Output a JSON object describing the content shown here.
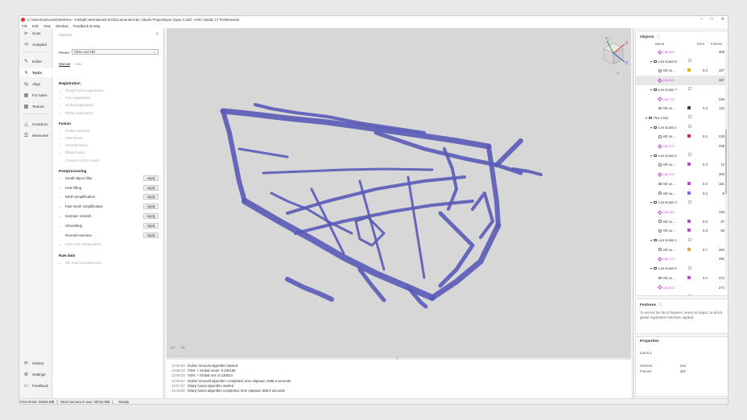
{
  "window": {
    "title": "C:\\Users\\u34ocan\\OneDrive - Kimball International Inc\\Documents\\Artec Studio Projects\\pos 2\\pos 2.a3d - Artec Studio 17 Professional",
    "minimize": "–",
    "maximize": "□",
    "close": "✕"
  },
  "menu": [
    "File",
    "Edit",
    "View",
    "Window",
    "Feedback & Help"
  ],
  "nav": {
    "items": [
      {
        "label": "Scan",
        "icon": "scan-icon",
        "glyph": "⊳"
      },
      {
        "label": "Autopilot",
        "icon": "autopilot-icon",
        "glyph": "⟲"
      },
      {
        "label": "Editor",
        "icon": "editor-icon",
        "glyph": "✎"
      },
      {
        "label": "Tools",
        "icon": "tools-icon",
        "glyph": "ϟ"
      },
      {
        "label": "Align",
        "icon": "align-icon",
        "glyph": "⇆"
      },
      {
        "label": "Fix holes",
        "icon": "fix-holes-icon",
        "glyph": "▦"
      },
      {
        "label": "Texture",
        "icon": "texture-icon",
        "glyph": "▩"
      },
      {
        "label": "Construct",
        "icon": "construct-icon",
        "glyph": "△"
      },
      {
        "label": "Measures",
        "icon": "measures-icon",
        "glyph": "☰"
      }
    ],
    "bottom": [
      {
        "label": "History",
        "icon": "history-icon",
        "glyph": "⟳"
      },
      {
        "label": "Settings",
        "icon": "settings-icon",
        "glyph": "⚙"
      },
      {
        "label": "Feedback",
        "icon": "feedback-icon",
        "glyph": "▭"
      }
    ]
  },
  "tools": {
    "header": "TOOLS",
    "preset_label": "Preset:",
    "preset_value": "Artec Leo HD",
    "tab_manual": "Manual",
    "tab_auto": "Auto",
    "sections": [
      {
        "title": "Registration",
        "rows": [
          {
            "label": "Rough serial registration",
            "enabled": false
          },
          {
            "label": "Fine registration",
            "enabled": false
          },
          {
            "label": "Global registration",
            "enabled": false
          },
          {
            "label": "Photo registration",
            "enabled": false
          }
        ]
      },
      {
        "title": "Fusion",
        "rows": [
          {
            "label": "Outlier removal",
            "enabled": false
          },
          {
            "label": "Fast fusion",
            "enabled": false
          },
          {
            "label": "Smooth fusion",
            "enabled": false
          },
          {
            "label": "Sharp fusion",
            "enabled": false
          },
          {
            "label": "Convert CAD to mesh",
            "enabled": false,
            "nochev": true
          }
        ]
      },
      {
        "title": "Postprocessing",
        "rows": [
          {
            "label": "Small-object filter",
            "enabled": true,
            "apply": "Apply"
          },
          {
            "label": "Hole filling",
            "enabled": true,
            "apply": "Apply"
          },
          {
            "label": "Mesh simplification",
            "enabled": true,
            "apply": "Apply"
          },
          {
            "label": "Fast mesh simplification",
            "enabled": true,
            "apply": "Apply"
          },
          {
            "label": "Isotropic remesh",
            "enabled": true,
            "apply": "Apply"
          },
          {
            "label": "Smoothing",
            "enabled": true,
            "apply": "Apply"
          },
          {
            "label": "Normal inversion",
            "enabled": true,
            "apply": "Apply",
            "nochev": true
          },
          {
            "label": "Fast scan triangulation",
            "enabled": false
          }
        ]
      },
      {
        "title": "Raw data",
        "rows": [
          {
            "label": "HD scan reconstruction",
            "enabled": false
          }
        ]
      }
    ]
  },
  "log": [
    {
      "time": "13:40:09",
      "text": "Outlier removal algorithm started"
    },
    {
      "time": "13:06:20",
      "text": "TSM: + Global mean: 0.330196"
    },
    {
      "time": "13:06:20",
      "text": "TSM: + Global rms: 0.130024"
    },
    {
      "time": "13:06:57",
      "text": "Outlier removal algorithm completed, time elapsed: 1586.4 seconds"
    },
    {
      "time": "13:07:57",
      "text": "Sharp fusion algorithm started"
    },
    {
      "time": "13:19:25",
      "text": "Sharp fusion algorithm completed, time elapsed: 688.9 seconds"
    }
  ],
  "status": {
    "free_ram": "Free RAM: 24929 MB",
    "total_mem": "Total memory in use: 28716 MB",
    "state": "Ready",
    "sep": "|"
  },
  "objects": {
    "title": "Objects",
    "info": "ⓘ",
    "col_name": "Name",
    "col_error": "Error",
    "col_frames": "Frames",
    "rows": [
      {
        "indent": 4,
        "type": "mesh",
        "name": "Leo 5.1",
        "frames": "308"
      },
      {
        "indent": 3,
        "type": "folder",
        "name": "Leo scans 6",
        "cb": true
      },
      {
        "indent": 4,
        "type": "scan",
        "name": "HD Le...",
        "swatch": "#e3b100",
        "error": "0.3",
        "frames": "327"
      },
      {
        "indent": 4,
        "type": "mesh",
        "name": "Leo 6.1",
        "frames": "327",
        "hl": true
      },
      {
        "indent": 3,
        "type": "folder",
        "name": "Leo scans 7",
        "cb": true
      },
      {
        "indent": 4,
        "type": "mesh",
        "name": "Leo 7.1",
        "frames": "236"
      },
      {
        "indent": 4,
        "type": "scan",
        "name": "HD Le...",
        "swatch": "#444444",
        "error": "0.4",
        "frames": "122"
      },
      {
        "indent": 2,
        "type": "folder",
        "name": "Pos 2 top",
        "cb": true
      },
      {
        "indent": 3,
        "type": "folder",
        "name": "Leo scans 1",
        "cb": true
      },
      {
        "indent": 4,
        "type": "scan",
        "name": "HD Le...",
        "swatch": "#d0205c",
        "error": "0.3",
        "frames": "228"
      },
      {
        "indent": 4,
        "type": "mesh",
        "name": "Leo 1.1",
        "frames": "228"
      },
      {
        "indent": 3,
        "type": "folder",
        "name": "Leo scans 2",
        "cb": true
      },
      {
        "indent": 4,
        "type": "scan",
        "name": "HD Le...",
        "swatch": "#c04bd0",
        "error": "0.3",
        "frames": "12"
      },
      {
        "indent": 4,
        "type": "mesh",
        "name": "Leo 2.1",
        "frames": "263"
      },
      {
        "indent": 4,
        "type": "scan",
        "name": "HD Le...",
        "swatch": "#c04bd0",
        "error": "0.3",
        "frames": "161"
      },
      {
        "indent": 4,
        "type": "scan",
        "name": "HD Le...",
        "swatch": "#9b5de5",
        "error": "0.2",
        "frames": "9"
      },
      {
        "indent": 3,
        "type": "folder",
        "name": "Leo scans 3",
        "cb": true
      },
      {
        "indent": 4,
        "type": "mesh",
        "name": "Leo 3.1",
        "frames": "125"
      },
      {
        "indent": 4,
        "type": "scan",
        "name": "HD Le...",
        "swatch": "#b44fc8",
        "error": "0.3",
        "frames": "37"
      },
      {
        "indent": 4,
        "type": "scan",
        "name": "HD Le...",
        "swatch": "#b44fc8",
        "error": "0.3",
        "frames": "55"
      },
      {
        "indent": 3,
        "type": "folder",
        "name": "Leo scans 4",
        "cb": true
      },
      {
        "indent": 4,
        "type": "scan",
        "name": "HD Le...",
        "swatch": "#e8a34a",
        "error": "0.7",
        "frames": "262"
      },
      {
        "indent": 4,
        "type": "mesh",
        "name": "Leo 4.1",
        "frames": "262"
      },
      {
        "indent": 3,
        "type": "folder",
        "name": "Leo scans 5",
        "cb": true
      },
      {
        "indent": 4,
        "type": "scan",
        "name": "HD Le...",
        "swatch": "#c04bd0",
        "error": "0.3",
        "frames": "272"
      },
      {
        "indent": 4,
        "type": "mesh",
        "name": "Leo 5.1",
        "frames": "272"
      },
      {
        "indent": 3,
        "type": "folder",
        "name": "Leo scans 6",
        "cb": true
      }
    ]
  },
  "features": {
    "title": "Features",
    "info": "ⓘ",
    "text": "To access the list of features, select an object, to which global registration has been applied."
  },
  "properties": {
    "title": "Properties",
    "name": "Leo 6.1",
    "scanner_label": "Scanner",
    "scanner_value": "Leo",
    "frames_label": "Frames",
    "frames_value": "327"
  },
  "viewport": {
    "model_color": "#5a5ab8",
    "axis_x": "X",
    "axis_y": "Y",
    "axis_z": "Z",
    "undo": "↶",
    "redo": "↷",
    "collapse": "▲"
  }
}
